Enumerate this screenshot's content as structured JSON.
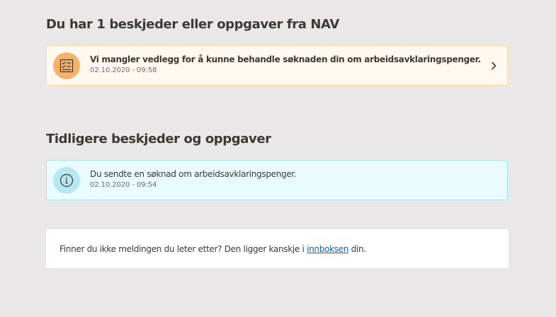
{
  "new_section": {
    "heading": "Du har 1 beskjeder eller oppgaver fra NAV",
    "items": [
      {
        "title": "Vi mangler vedlegg for å kunne behandle søknaden din om arbeidsavklaringspenger.",
        "date": "02.10.2020 - 09:58",
        "icon": "checklist-icon",
        "accent": "#f6b26a"
      }
    ]
  },
  "old_section": {
    "heading": "Tidligere beskjeder og oppgaver",
    "items": [
      {
        "title": "Du sendte en søknad om arbeidsavklaringspenger.",
        "date": "02.10.2020 - 09:54",
        "icon": "info-icon",
        "accent": "#b7e8f1"
      }
    ]
  },
  "footer": {
    "text_before": "Finner du ikke meldingen du leter etter? Den ligger kanskje i ",
    "link_text": "innboksen",
    "text_after": " din."
  },
  "colors": {
    "background": "#e9e7e7",
    "task_bg": "#fff9f0",
    "task_border": "#ffd8a3",
    "info_bg": "#e9fbfc",
    "info_border": "#a6e3ea",
    "link": "#0067c5"
  }
}
